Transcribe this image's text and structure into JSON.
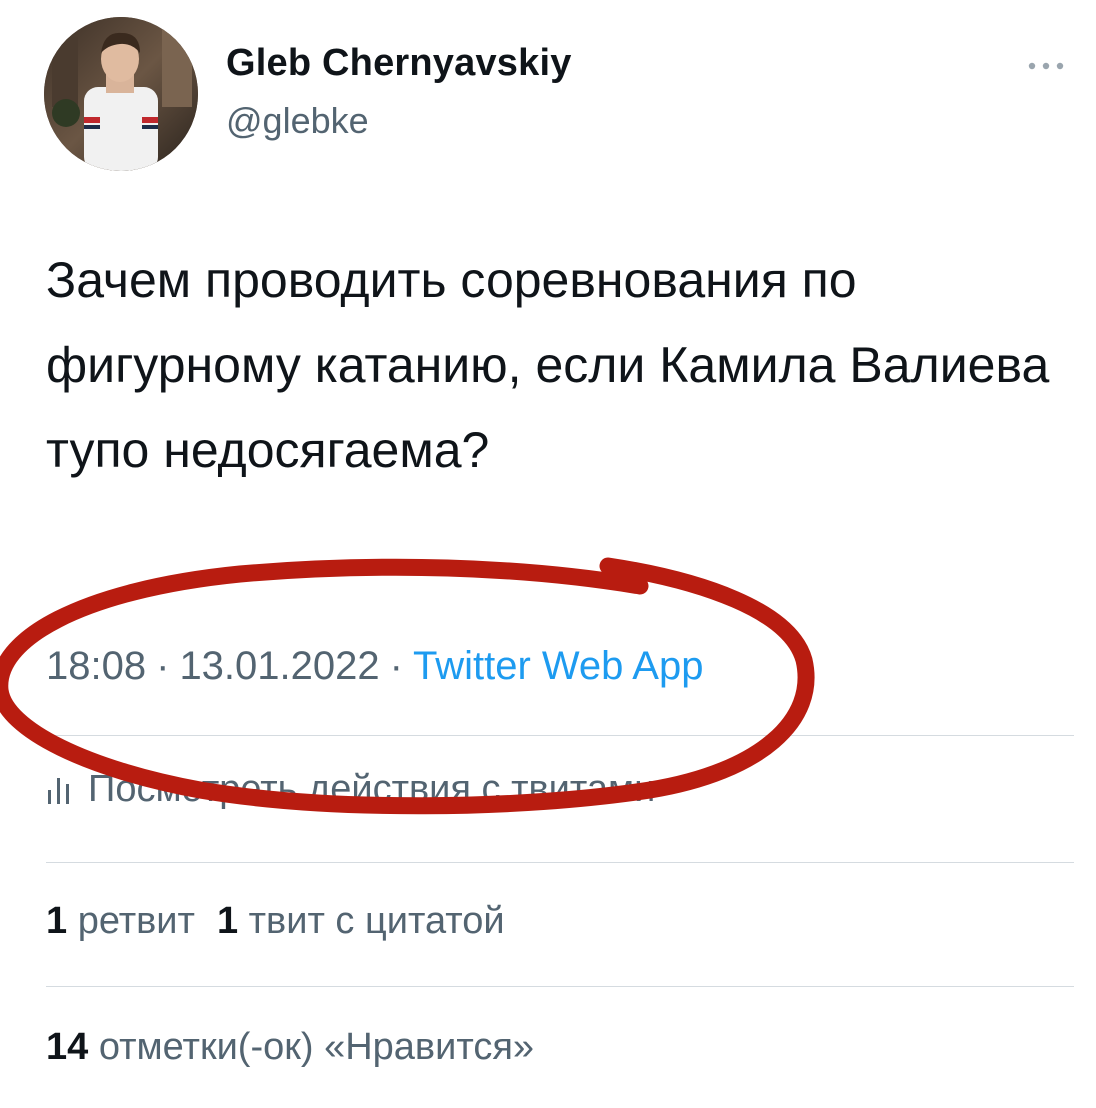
{
  "author": {
    "name": "Gleb Chernyavskiy",
    "handle": "@glebke"
  },
  "tweet": {
    "text": "Зачем проводить соревнования по фигурному катанию, если Камила Валиева тупо недосягаема?"
  },
  "meta": {
    "time": "18:08",
    "separator": "·",
    "date": "13.01.2022",
    "source": "Twitter Web App"
  },
  "analytics": {
    "label": "Посмотреть действия с твитами"
  },
  "stats": {
    "retweets": {
      "count": "1",
      "label": "ретвит"
    },
    "quotes": {
      "count": "1",
      "label": "твит с цитатой"
    },
    "likes": {
      "count": "14",
      "label": "отметки(-ок) «Нравится»"
    }
  },
  "colors": {
    "text": "#0f1419",
    "secondary": "#536471",
    "link": "#1d9bf0",
    "annotation": "#b81c10"
  },
  "icons": {
    "more": "more-icon",
    "analytics": "analytics-icon"
  }
}
